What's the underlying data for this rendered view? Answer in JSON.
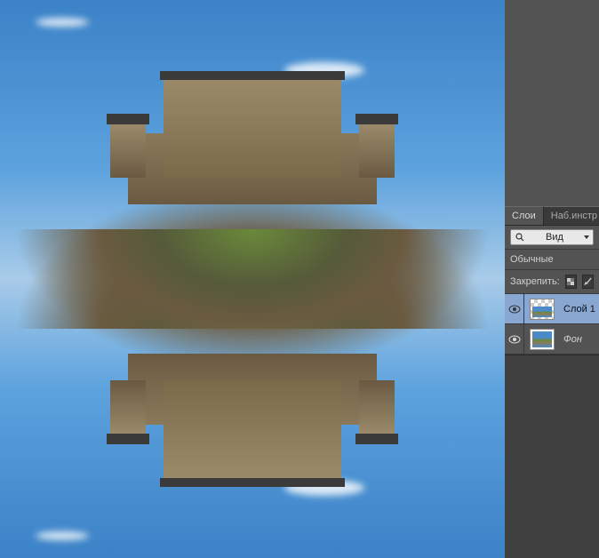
{
  "panel": {
    "tabs": {
      "layers": "Слои",
      "toolsets": "Наб.инстр"
    },
    "filter_kind_label": "Вид",
    "blend_mode_label": "Обычные",
    "lock_label": "Закрепить:"
  },
  "layers": [
    {
      "name": "Слой 1",
      "visible": true,
      "selected": true,
      "has_transparency": true
    },
    {
      "name": "Фон",
      "visible": true,
      "selected": false,
      "has_transparency": false
    }
  ],
  "icons": {
    "search": "search-icon",
    "eye": "eye-icon",
    "lock_pixels": "lock-pixels-icon",
    "brush": "brush-icon",
    "move": "move-icon"
  }
}
